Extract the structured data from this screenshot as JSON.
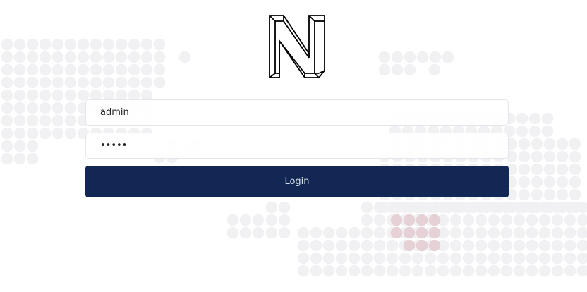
{
  "logo": {
    "icon": "n-logo-icon"
  },
  "form": {
    "username_value": "admin",
    "password_value": "12345",
    "login_label": "Login"
  },
  "colors": {
    "button_bg": "#122753",
    "button_text": "#d7deea",
    "dot_gray": "#f1f1f3",
    "dot_pink": "#e6d2d6"
  }
}
